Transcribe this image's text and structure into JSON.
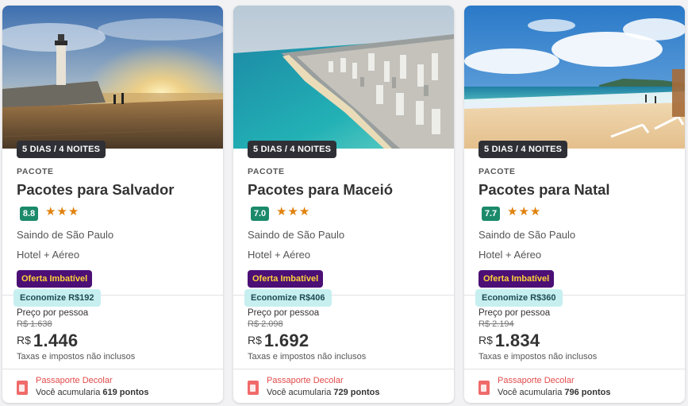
{
  "cards": [
    {
      "image": "salvador-lighthouse-beach",
      "duration": "5 DIAS / 4 NOITES",
      "type": "PACOTE",
      "title": "Pacotes para Salvador",
      "score": "8.8",
      "stars": "★★★",
      "origin": "Saindo de São Paulo",
      "kind": "Hotel + Aéreo",
      "offer": "Oferta Imbatível",
      "savings": "Economize R$192",
      "price_label": "Preço por pessoa",
      "old_price": "R$ 1.638",
      "currency": "R$",
      "price": "1.446",
      "taxes": "Taxas e impostos não inclusos",
      "program": "Passaporte Decolar",
      "points_prefix": "Você acumularia",
      "points": "619 pontos"
    },
    {
      "image": "maceio-aerial-coast",
      "duration": "5 DIAS / 4 NOITES",
      "type": "PACOTE",
      "title": "Pacotes para Maceió",
      "score": "7.0",
      "stars": "★★★",
      "origin": "Saindo de São Paulo",
      "kind": "Hotel + Aéreo",
      "offer": "Oferta Imbatível",
      "savings": "Economize R$406",
      "price_label": "Preço por pessoa",
      "old_price": "R$ 2.098",
      "currency": "R$",
      "price": "1.692",
      "taxes": "Taxas e impostos não inclusos",
      "program": "Passaporte Decolar",
      "points_prefix": "Você acumularia",
      "points": "729 pontos"
    },
    {
      "image": "natal-beach-chairs",
      "duration": "5 DIAS / 4 NOITES",
      "type": "PACOTE",
      "title": "Pacotes para Natal",
      "score": "7.7",
      "stars": "★★★",
      "origin": "Saindo de São Paulo",
      "kind": "Hotel + Aéreo",
      "offer": "Oferta Imbatível",
      "savings": "Economize R$360",
      "price_label": "Preço por pessoa",
      "old_price": "R$ 2.194",
      "currency": "R$",
      "price": "1.834",
      "taxes": "Taxas e impostos não inclusos",
      "program": "Passaporte Decolar",
      "points_prefix": "Você acumularia",
      "points": "796 pontos"
    }
  ],
  "colors": {
    "score_bg": "#1b8a6b",
    "stars": "#e0820e",
    "offer_bg": "#4b0f75",
    "offer_text": "#ffd23a",
    "savings_bg": "#c7eff0",
    "program_text": "#e24b4b"
  }
}
